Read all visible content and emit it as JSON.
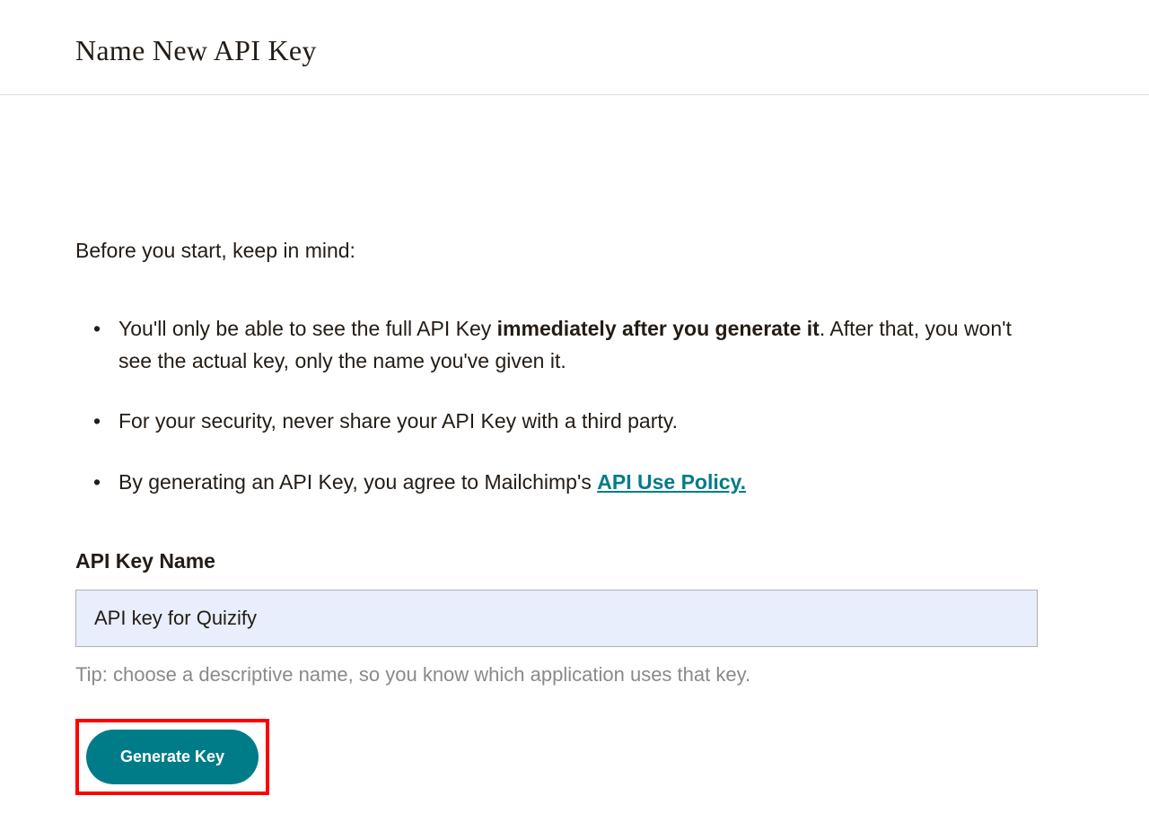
{
  "header": {
    "title": "Name New API Key"
  },
  "content": {
    "intro": "Before you start, keep in mind:",
    "bullets": {
      "item1_pre": "You'll only be able to see the full API Key ",
      "item1_bold": "immediately after you generate it",
      "item1_post": ". After that, you won't see the actual key, only the name you've given it.",
      "item2": "For your security, never share your API Key with a third party.",
      "item3_pre": "By generating an API Key, you agree to Mailchimp's ",
      "item3_link": "API Use Policy."
    },
    "field_label": "API Key Name",
    "field_value": "API key for Quizify",
    "tip": "Tip: choose a descriptive name, so you know which application uses that key.",
    "button_label": "Generate Key"
  }
}
